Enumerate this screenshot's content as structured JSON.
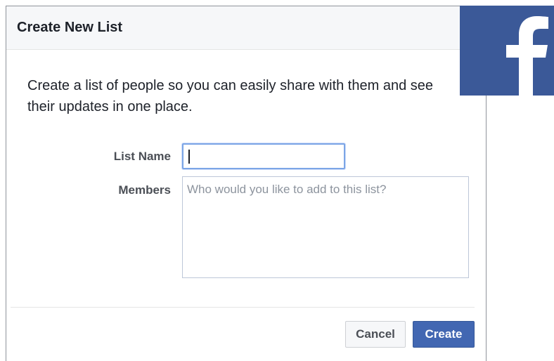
{
  "dialog": {
    "title": "Create New List",
    "intro": "Create a list of people so you can easily share with them and see their updates in one place.",
    "fields": {
      "list_name_label": "List Name",
      "list_name_value": "",
      "members_label": "Members",
      "members_placeholder": "Who would you like to add to this list?"
    },
    "buttons": {
      "cancel": "Cancel",
      "create": "Create"
    }
  },
  "brand": {
    "logo_icon": "facebook-f-icon",
    "color": "#3b5998"
  },
  "colors": {
    "primary_button": "#4267b2",
    "focus_border": "#7ca5e6",
    "header_bg": "#f6f7f9"
  }
}
